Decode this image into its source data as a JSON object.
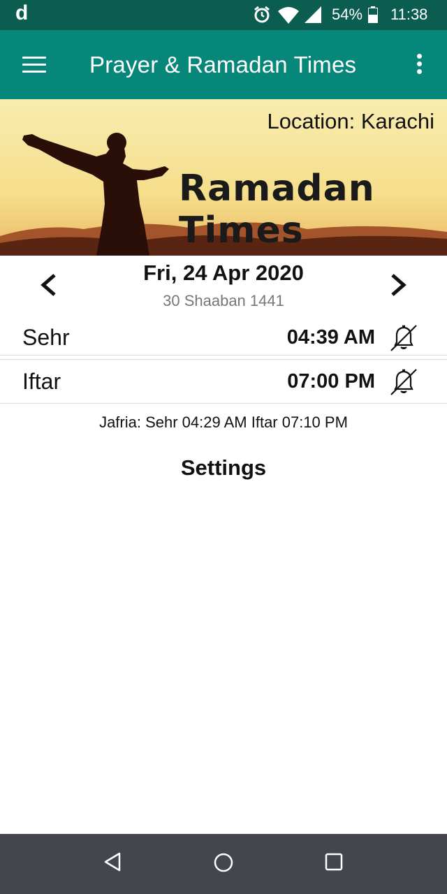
{
  "status_bar": {
    "app_letter": "d",
    "battery": "54%",
    "time": "11:38",
    "icons": [
      "alarm-icon",
      "wifi-icon",
      "signal-icon",
      "battery-icon"
    ]
  },
  "app_bar": {
    "title": "Prayer & Ramadan Times",
    "menu_icon": "hamburger-menu-icon",
    "overflow_icon": "more-vert-icon"
  },
  "banner": {
    "location": "Location: Karachi",
    "title": "Ramadan Times"
  },
  "date_nav": {
    "gregorian": "Fri, 24 Apr 2020",
    "hijri": "30 Shaaban 1441",
    "prev_icon": "chevron-left-icon",
    "next_icon": "chevron-right-icon"
  },
  "times": [
    {
      "label": "Sehr",
      "value": "04:39 AM",
      "alarm_icon": "alarm-off-bell-icon"
    },
    {
      "label": "Iftar",
      "value": "07:00 PM",
      "alarm_icon": "alarm-off-bell-icon"
    }
  ],
  "jafria": "Jafria: Sehr 04:29 AM  Iftar 07:10 PM",
  "settings_label": "Settings",
  "colors": {
    "status_bar": "#0b5d4f",
    "app_bar": "#07867a",
    "nav_bar": "#43474d",
    "banner_sky": "#f6e49a"
  }
}
